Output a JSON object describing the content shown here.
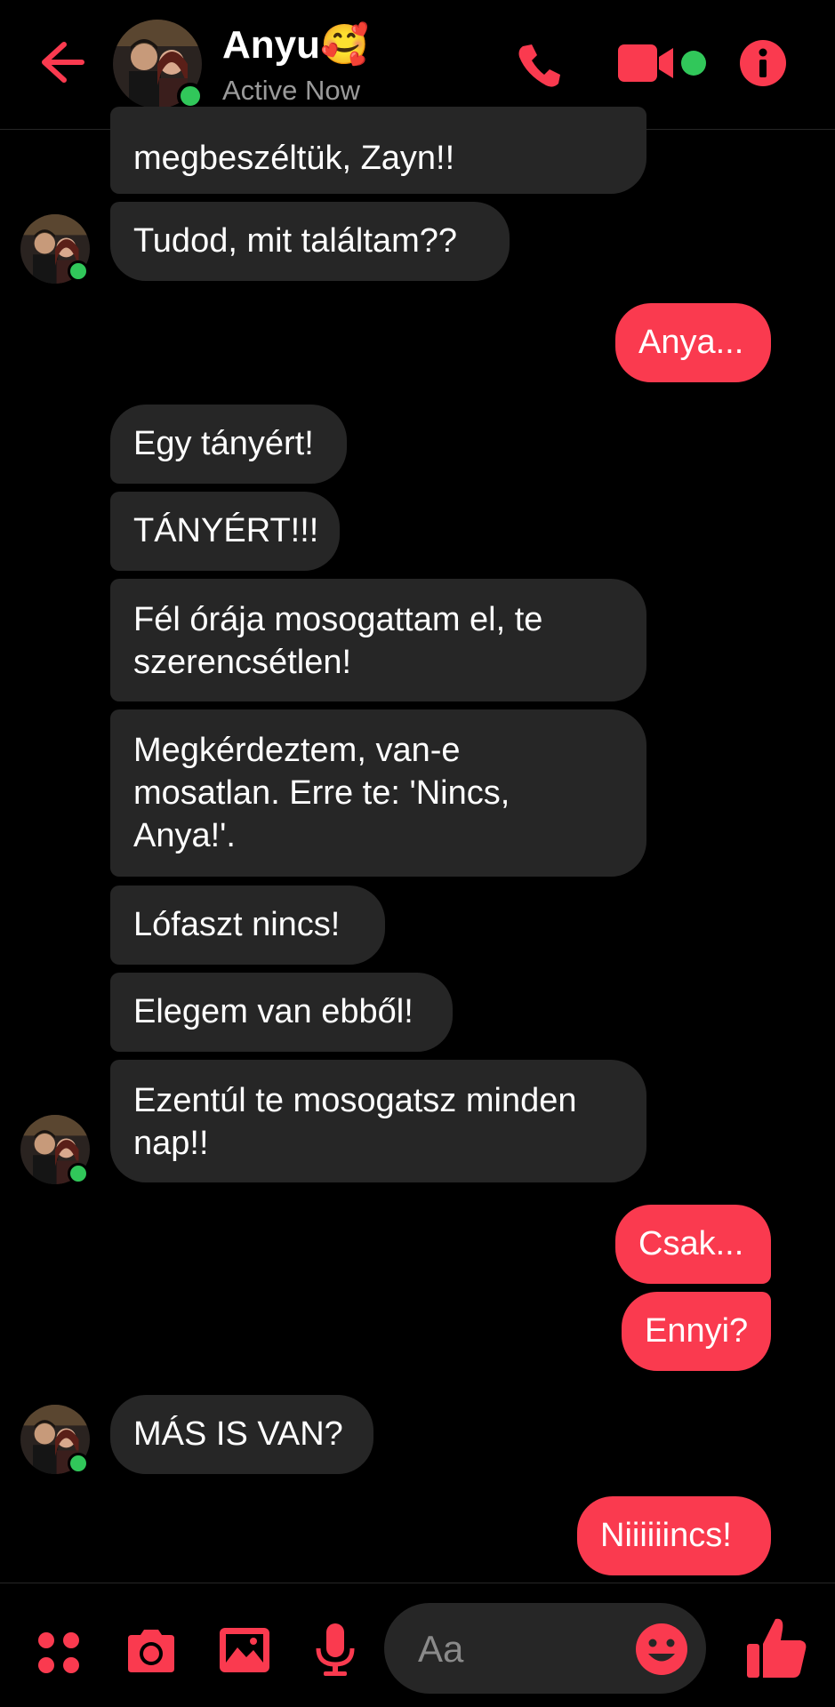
{
  "header": {
    "title": "Anyu🥰",
    "status": "Active Now"
  },
  "messages": [
    {
      "side": "received",
      "lines": [
        "megbeszéltük, Zayn!!"
      ]
    },
    {
      "side": "received",
      "lines": [
        "Tudod, mit találtam??"
      ]
    },
    {
      "side": "sent",
      "lines": [
        "Anya..."
      ]
    },
    {
      "side": "received",
      "lines": [
        "Egy tányért!"
      ]
    },
    {
      "side": "received",
      "lines": [
        "TÁNYÉRT!!!"
      ]
    },
    {
      "side": "received",
      "lines": [
        "Fél órája mosogattam el, te",
        "szerencsétlen!"
      ]
    },
    {
      "side": "received",
      "lines": [
        "Megkérdeztem, van-e",
        "mosatlan. Erre te: 'Nincs,",
        "Anya!'."
      ]
    },
    {
      "side": "received",
      "lines": [
        "Lófaszt nincs!"
      ]
    },
    {
      "side": "received",
      "lines": [
        "Elegem van ebből!"
      ]
    },
    {
      "side": "received",
      "lines": [
        "Ezentúl te mosogatsz minden",
        "nap!!"
      ]
    },
    {
      "side": "sent",
      "lines": [
        "Csak..."
      ]
    },
    {
      "side": "sent",
      "lines": [
        "Ennyi?"
      ]
    },
    {
      "side": "received",
      "lines": [
        "MÁS IS VAN?"
      ]
    },
    {
      "side": "sent",
      "lines": [
        "Niiiiiincs!"
      ]
    }
  ],
  "composer": {
    "placeholder": "Aa"
  },
  "icons": {
    "back": "back-arrow-icon",
    "call": "phone-icon",
    "video": "video-camera-icon",
    "info": "info-icon",
    "apps": "four-dots-icon",
    "camera": "camera-icon",
    "gallery": "image-icon",
    "mic": "microphone-icon",
    "emoji": "emoji-icon",
    "like": "thumbs-up-icon"
  },
  "colors": {
    "accent": "#fa3a4f",
    "received_bubble": "#262626",
    "background": "#000000",
    "presence": "#31c75a"
  }
}
